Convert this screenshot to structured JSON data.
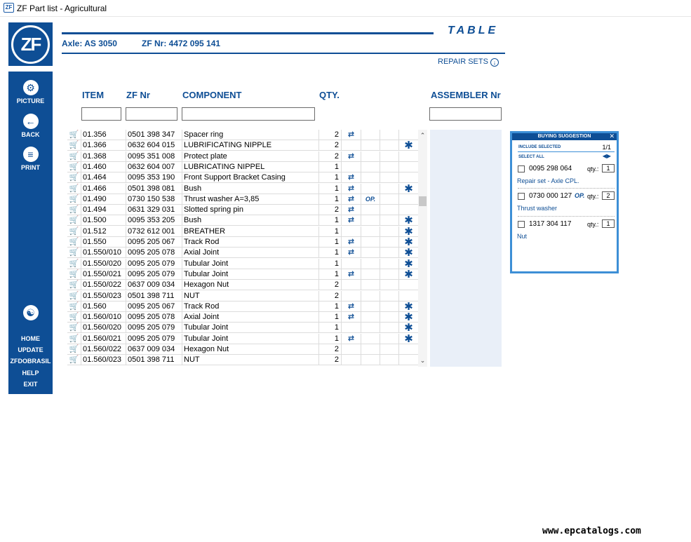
{
  "window": {
    "title": "ZF Part list - Agricultural",
    "icon_text": "ZF"
  },
  "logo": {
    "text": "ZF"
  },
  "header": {
    "view_title": "TABLE",
    "axle": "Axle: AS 3050",
    "zf_nr": "ZF Nr: 4472 095 141",
    "repair_sets": "REPAIR SETS"
  },
  "sidebar": {
    "picture": "PICTURE",
    "back": "BACK",
    "print": "PRINT",
    "home": "HOME",
    "update": "UPDATE",
    "zfdobrasil": "ZFDOBRASIL",
    "help": "HELP",
    "exit": "EXIT"
  },
  "columns": {
    "item": "ITEM",
    "zf_nr": "ZF Nr",
    "component": "COMPONENT",
    "qty": "QTY.",
    "assembler_nr": "ASSEMBLER Nr"
  },
  "filters": {
    "item": "",
    "zf_nr": "",
    "component": "",
    "assembler_nr": ""
  },
  "rows": [
    {
      "item": "01.356",
      "zf": "0501 398 347",
      "comp": "Spacer ring",
      "qty": "2",
      "ic1": true,
      "op": "",
      "star": false
    },
    {
      "item": "01.366",
      "zf": "0632 604 015",
      "comp": "LUBRIFICATING NIPPLE",
      "qty": "2",
      "ic1": false,
      "op": "",
      "star": true
    },
    {
      "item": "01.368",
      "zf": "0095 351 008",
      "comp": "Protect plate",
      "qty": "2",
      "ic1": true,
      "op": "",
      "star": false
    },
    {
      "item": "01.460",
      "zf": "0632 604 007",
      "comp": "LUBRICATING NIPPEL",
      "qty": "1",
      "ic1": false,
      "op": "",
      "star": false
    },
    {
      "item": "01.464",
      "zf": "0095 353 190",
      "comp": "Front Support Bracket Casing",
      "qty": "1",
      "ic1": true,
      "op": "",
      "star": false
    },
    {
      "item": "01.466",
      "zf": "0501 398 081",
      "comp": "Bush",
      "qty": "1",
      "ic1": true,
      "op": "",
      "star": true
    },
    {
      "item": "01.490",
      "zf": "0730 150 538",
      "comp": "Thrust washer A=3,85",
      "qty": "1",
      "ic1": true,
      "op": "OP.",
      "star": false
    },
    {
      "item": "01.494",
      "zf": "0631 329 031",
      "comp": "Slotted spring pin",
      "qty": "2",
      "ic1": true,
      "op": "",
      "star": false
    },
    {
      "item": "01.500",
      "zf": "0095 353 205",
      "comp": "Bush",
      "qty": "1",
      "ic1": true,
      "op": "",
      "star": true
    },
    {
      "item": "01.512",
      "zf": "0732 612 001",
      "comp": "BREATHER",
      "qty": "1",
      "ic1": false,
      "op": "",
      "star": true
    },
    {
      "item": "01.550",
      "zf": "0095 205 067",
      "comp": "Track Rod",
      "qty": "1",
      "ic1": true,
      "op": "",
      "star": true
    },
    {
      "item": "01.550/010",
      "zf": "0095 205 078",
      "comp": "Axial Joint",
      "qty": "1",
      "ic1": true,
      "op": "",
      "star": true
    },
    {
      "item": "01.550/020",
      "zf": "0095 205 079",
      "comp": "Tubular Joint",
      "qty": "1",
      "ic1": false,
      "op": "",
      "star": true
    },
    {
      "item": "01.550/021",
      "zf": "0095 205 079",
      "comp": "Tubular Joint",
      "qty": "1",
      "ic1": true,
      "op": "",
      "star": true
    },
    {
      "item": "01.550/022",
      "zf": "0637 009 034",
      "comp": "Hexagon Nut",
      "qty": "2",
      "ic1": false,
      "op": "",
      "star": false
    },
    {
      "item": "01.550/023",
      "zf": "0501 398 711",
      "comp": "NUT",
      "qty": "2",
      "ic1": false,
      "op": "",
      "star": false
    },
    {
      "item": "01.560",
      "zf": "0095 205 067",
      "comp": "Track Rod",
      "qty": "1",
      "ic1": true,
      "op": "",
      "star": true
    },
    {
      "item": "01.560/010",
      "zf": "0095 205 078",
      "comp": "Axial Joint",
      "qty": "1",
      "ic1": true,
      "op": "",
      "star": true
    },
    {
      "item": "01.560/020",
      "zf": "0095 205 079",
      "comp": "Tubular Joint",
      "qty": "1",
      "ic1": false,
      "op": "",
      "star": true
    },
    {
      "item": "01.560/021",
      "zf": "0095 205 079",
      "comp": "Tubular Joint",
      "qty": "1",
      "ic1": true,
      "op": "",
      "star": true
    },
    {
      "item": "01.560/022",
      "zf": "0637 009 034",
      "comp": "Hexagon Nut",
      "qty": "2",
      "ic1": false,
      "op": "",
      "star": false
    },
    {
      "item": "01.560/023",
      "zf": "0501 398 711",
      "comp": "NUT",
      "qty": "2",
      "ic1": false,
      "op": "",
      "star": false
    }
  ],
  "buying": {
    "title": "BUYING SUGGESTION",
    "include_selected": "INCLUDE SELECTED",
    "page": "1/1",
    "select_all": "SELECT ALL",
    "qty_label": "qty.:",
    "items": [
      {
        "part": "0095 298 064",
        "qty": "1",
        "desc": "Repair set - Axle CPL.",
        "op": ""
      },
      {
        "part": "0730 000 127",
        "qty": "2",
        "desc": "Thrust washer",
        "op": "OP."
      },
      {
        "part": "1317 304 117",
        "qty": "1",
        "desc": "Nut",
        "op": ""
      }
    ]
  },
  "watermark": "www.epcatalogs.com",
  "colors": {
    "brand_blue": "#0e4e95",
    "panel_blue": "#e9eff8",
    "popup_border": "#3d8fd6"
  }
}
